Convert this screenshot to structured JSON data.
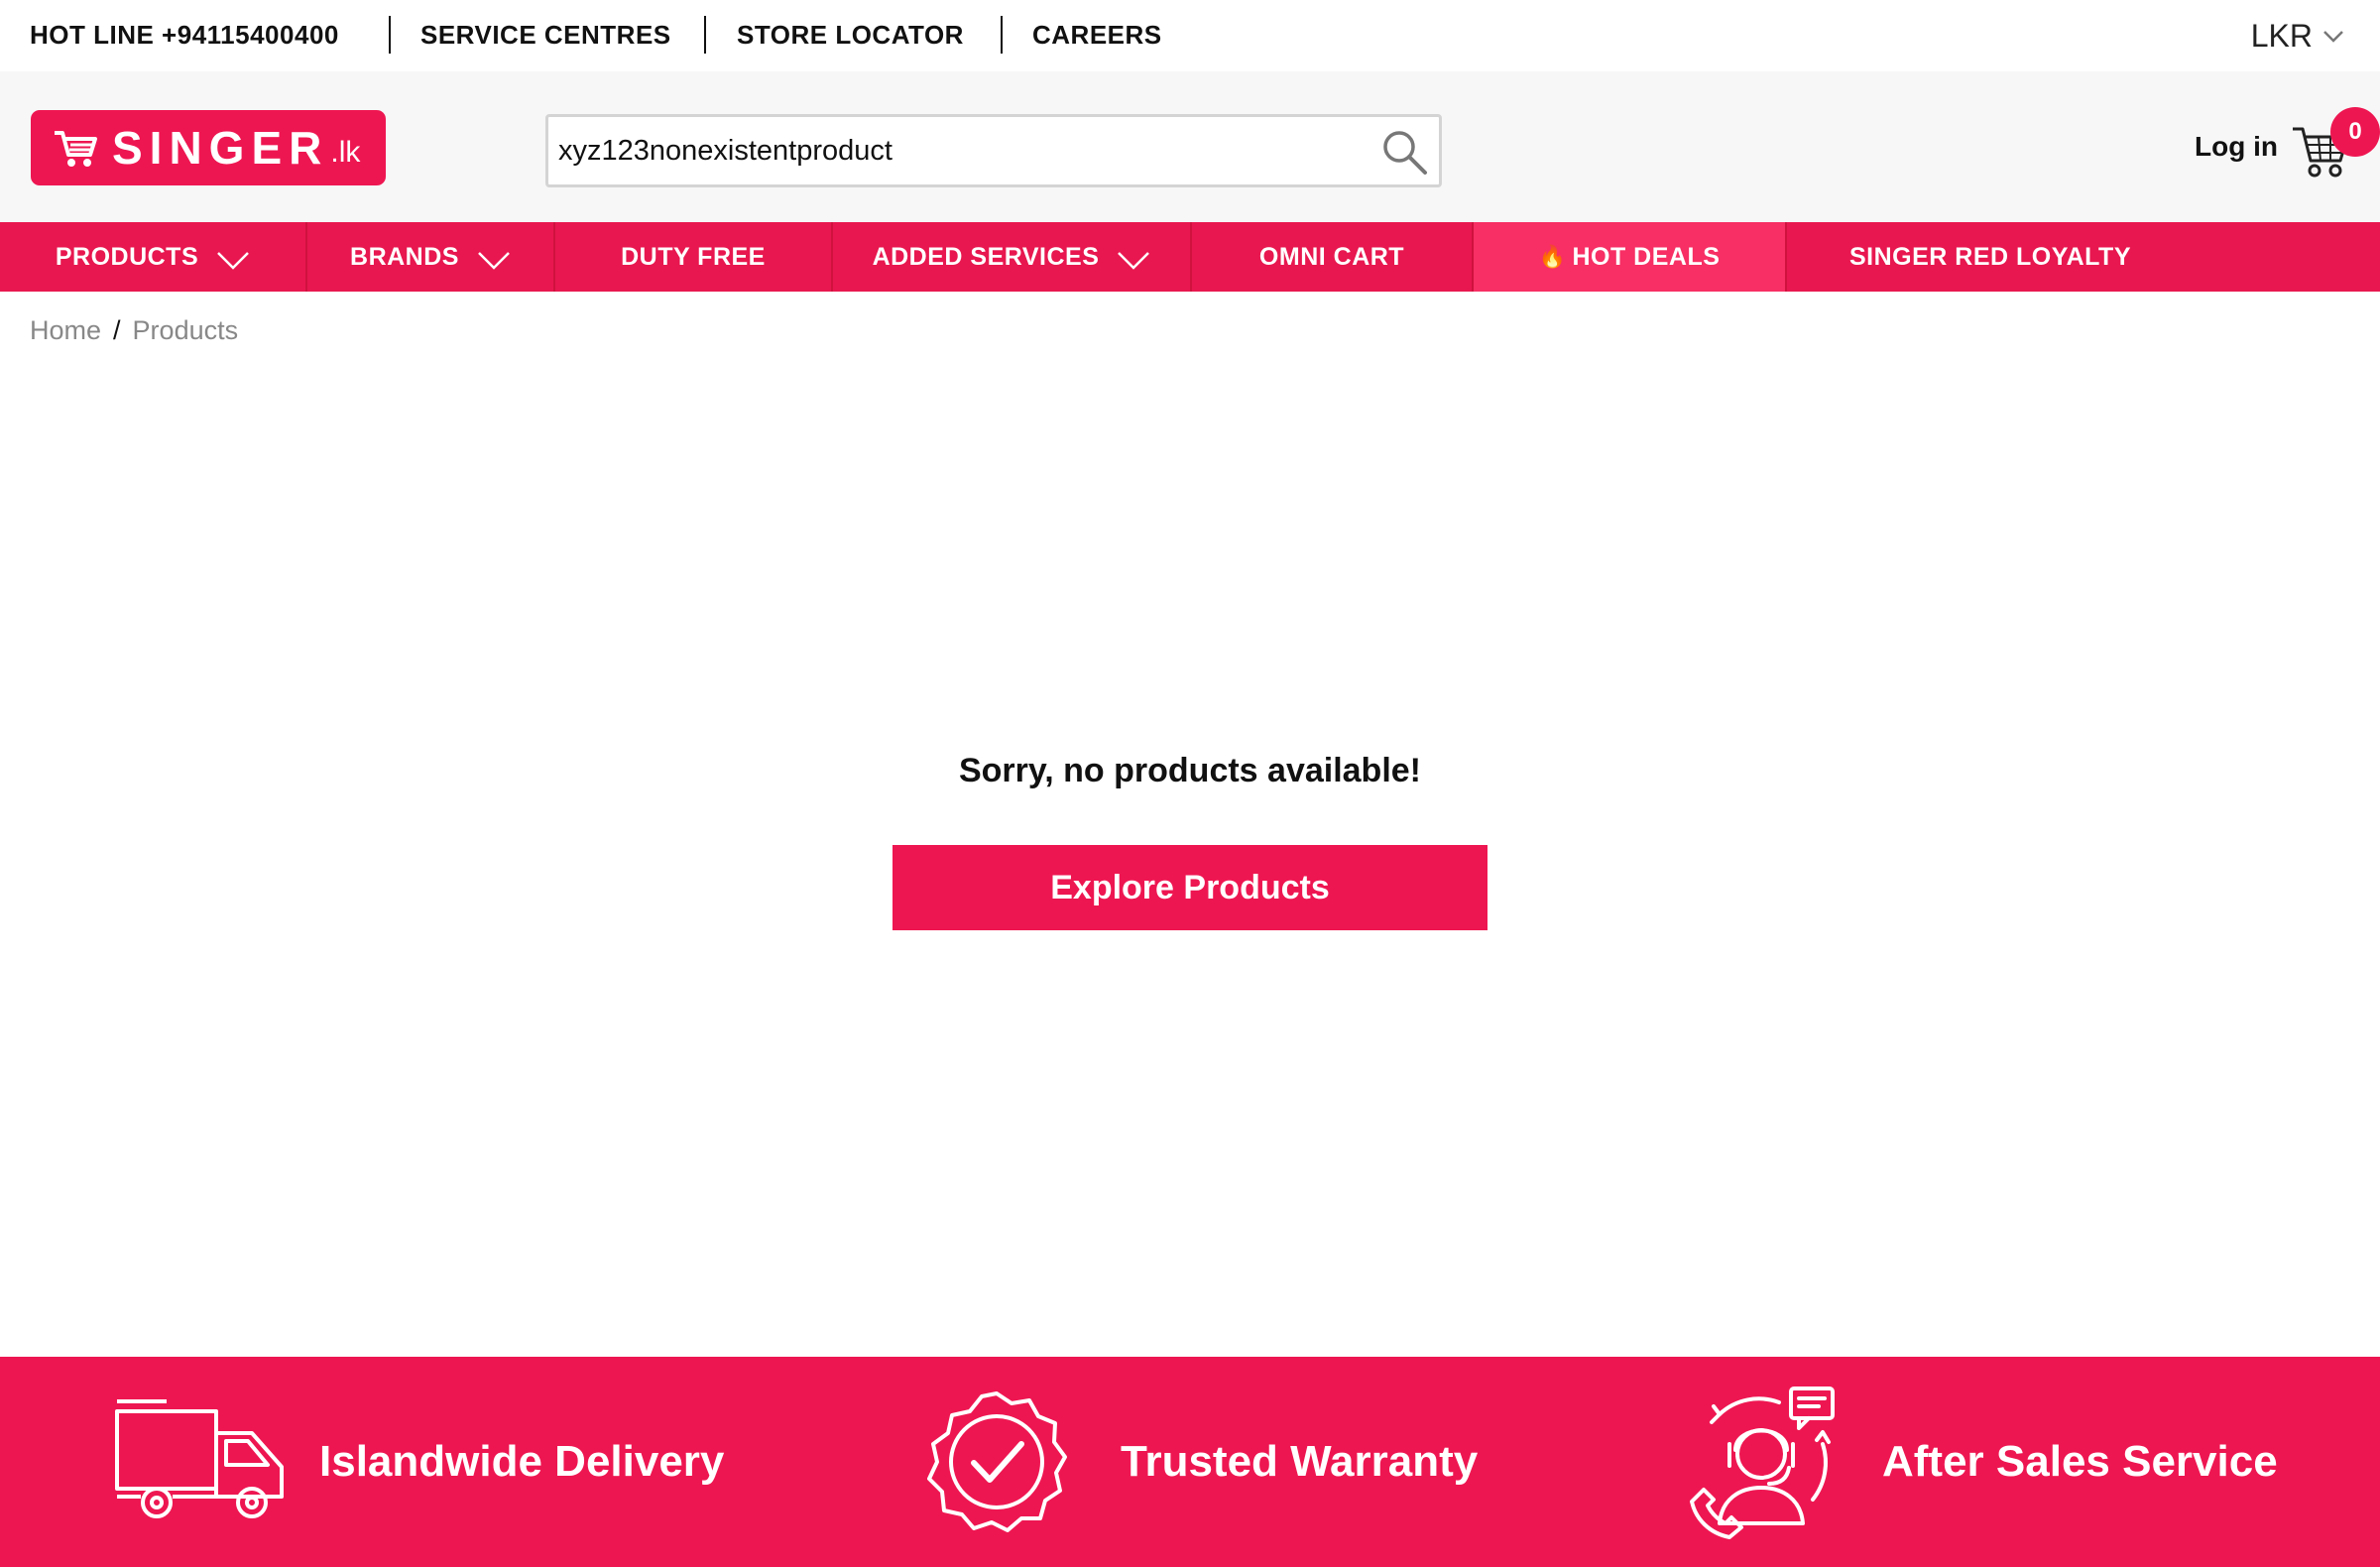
{
  "topbar": {
    "hotline": "HOT LINE +94115400400",
    "service_centres": "SERVICE CENTRES",
    "store_locator": "STORE LOCATOR",
    "careers": "CAREERS",
    "currency": "LKR"
  },
  "header": {
    "logo_brand": "SINGER",
    "logo_tld": ".lk",
    "search_value": "xyz123nonexistentproduct",
    "login_label": "Log in",
    "cart_count": "0"
  },
  "nav": {
    "items": [
      {
        "label": "PRODUCTS",
        "has_dropdown": true
      },
      {
        "label": "BRANDS",
        "has_dropdown": true
      },
      {
        "label": "DUTY FREE",
        "has_dropdown": false
      },
      {
        "label": "ADDED SERVICES",
        "has_dropdown": true
      },
      {
        "label": "OMNI CART",
        "has_dropdown": false
      },
      {
        "label": "HOT DEALS",
        "has_dropdown": false,
        "icon": "flame-icon"
      },
      {
        "label": "SINGER RED LOYALTY",
        "has_dropdown": false
      }
    ]
  },
  "breadcrumb": {
    "home": "Home",
    "current": "Products"
  },
  "main": {
    "empty_message": "Sorry, no products available!",
    "explore_button": "Explore Products"
  },
  "features": {
    "delivery": "Islandwide Delivery",
    "warranty": "Trusted Warranty",
    "after_sales": "After Sales Service"
  },
  "colors": {
    "brand": "#ee1651",
    "nav_bg": "#e8174f",
    "hot_deals_bg": "#f72f64"
  }
}
